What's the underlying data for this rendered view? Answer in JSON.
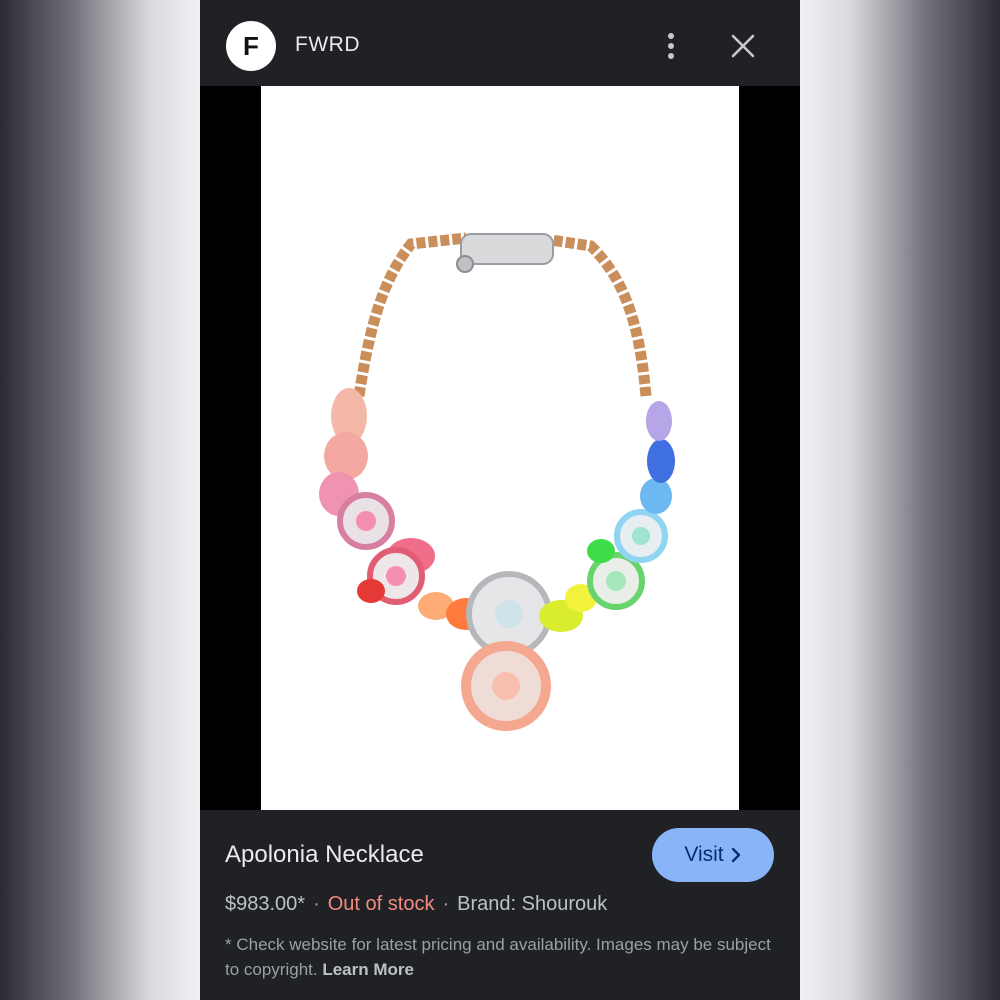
{
  "header": {
    "logo_letter": "F",
    "site_name": "FWRD"
  },
  "product": {
    "title": "Apolonia Necklace",
    "price": "$983.00*",
    "separator": "·",
    "stock_status": "Out of stock",
    "brand": "Brand: Shourouk",
    "visit_label": "Visit",
    "disclaimer": "* Check website for latest pricing and availability. Images may be subject to copyright.",
    "learn_more": "Learn More"
  },
  "icons": {
    "more": "more-vert-icon",
    "close": "close-icon",
    "lens": "lens-search-icon",
    "chevron": "chevron-right-icon"
  },
  "colors": {
    "panel_bg": "#202124",
    "visit_button": "#8ab4f8",
    "out_of_stock": "#f28b82"
  }
}
